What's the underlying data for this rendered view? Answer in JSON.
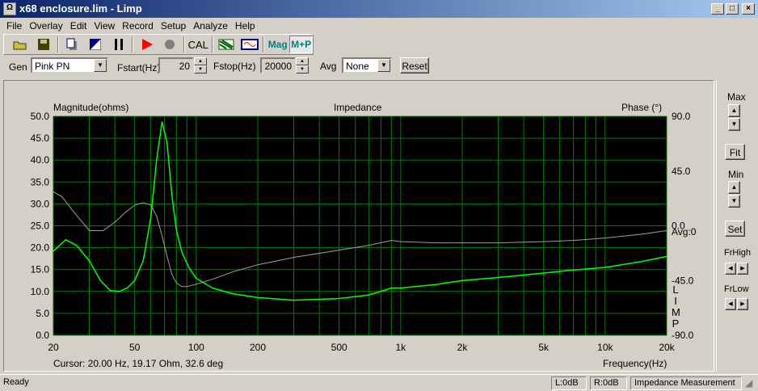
{
  "window": {
    "title": "x68 enclosure.lim - Limp",
    "icon": "app-icon",
    "controls": [
      "_",
      "□",
      "×"
    ]
  },
  "menu": [
    "File",
    "Overlay",
    "Edit",
    "View",
    "Record",
    "Setup",
    "Analyze",
    "Help"
  ],
  "toolbar": {
    "cal": "CAL",
    "mag": "Mag",
    "mp": "M+P"
  },
  "gen": {
    "label": "Gen",
    "value": "Pink PN",
    "fstart_label": "Fstart(Hz)",
    "fstart": "20",
    "fstop_label": "Fstop(Hz)",
    "fstop": "20000",
    "avg_label": "Avg",
    "avg": "None",
    "reset": "Reset"
  },
  "right_panel": {
    "max": "Max",
    "fit": "Fit",
    "min": "Min",
    "set": "Set",
    "frhigh": "FrHigh",
    "frlow": "FrLow"
  },
  "chart_data": {
    "type": "line",
    "title": "Impedance",
    "ylabel": "Magnitude(ohms)",
    "y2label": "Phase (°)",
    "xlabel": "Frequency(Hz)",
    "xscale": "log",
    "xlim": [
      20,
      20000
    ],
    "ylim": [
      0,
      50
    ],
    "y2lim": [
      -90,
      90
    ],
    "xticks": [
      "20",
      "50",
      "100",
      "200",
      "500",
      "1k",
      "2k",
      "5k",
      "10k",
      "20k"
    ],
    "xtick_values": [
      20,
      50,
      100,
      200,
      500,
      1000,
      2000,
      5000,
      10000,
      20000
    ],
    "yticks": [
      "50.0",
      "45.0",
      "40.0",
      "35.0",
      "30.0",
      "25.0",
      "20.0",
      "15.0",
      "10.0",
      "5.0",
      "0.0"
    ],
    "y2ticks": [
      "90.0",
      "45.0",
      "0.0",
      "-45.0",
      "-90.0"
    ],
    "avg_label": "Avg:0",
    "side_label": [
      "L",
      "I",
      "M",
      "P"
    ],
    "series": [
      {
        "name": "Magnitude",
        "color": "#00ff00",
        "x": [
          20,
          23,
          26,
          30,
          34,
          38,
          42,
          46,
          50,
          55,
          60,
          64,
          68,
          72,
          76,
          80,
          85,
          92,
          100,
          120,
          150,
          200,
          300,
          500,
          700,
          900,
          1000,
          1500,
          2000,
          3000,
          5000,
          7000,
          10000,
          15000,
          20000
        ],
        "y": [
          19.2,
          21.8,
          20.5,
          17,
          12.5,
          10.2,
          10,
          10.8,
          12.5,
          17,
          27,
          40,
          48.8,
          44,
          32,
          24,
          19,
          15.5,
          13,
          10.8,
          9.5,
          8.6,
          8.0,
          8.4,
          9.2,
          10.8,
          10.8,
          11.6,
          12.5,
          13.2,
          14.2,
          14.9,
          15.5,
          16.8,
          18
        ]
      },
      {
        "name": "Phase",
        "color": "#a0a0a0",
        "x": [
          20,
          22,
          25,
          30,
          35,
          40,
          45,
          50,
          55,
          60,
          64,
          68,
          72,
          76,
          80,
          85,
          90,
          100,
          120,
          150,
          200,
          300,
          500,
          700,
          900,
          1000,
          1500,
          2000,
          3000,
          5000,
          7000,
          10000,
          15000,
          20000
        ],
        "y": [
          28,
          24,
          12,
          -4,
          -4,
          3,
          11,
          17,
          19,
          17,
          8,
          -8,
          -25,
          -40,
          -47,
          -50,
          -50,
          -48,
          -44,
          -38,
          -32,
          -26,
          -20,
          -16,
          -12,
          -13,
          -14,
          -14,
          -14,
          -13,
          -12,
          -10,
          -7,
          -4
        ]
      }
    ]
  },
  "cursor": "Cursor: 20.00 Hz, 19.17 Ohm, 32.6 deg",
  "status": {
    "text": "Ready",
    "left": "L:0dB",
    "right": "R:0dB",
    "mode": "Impedance Measurement"
  }
}
